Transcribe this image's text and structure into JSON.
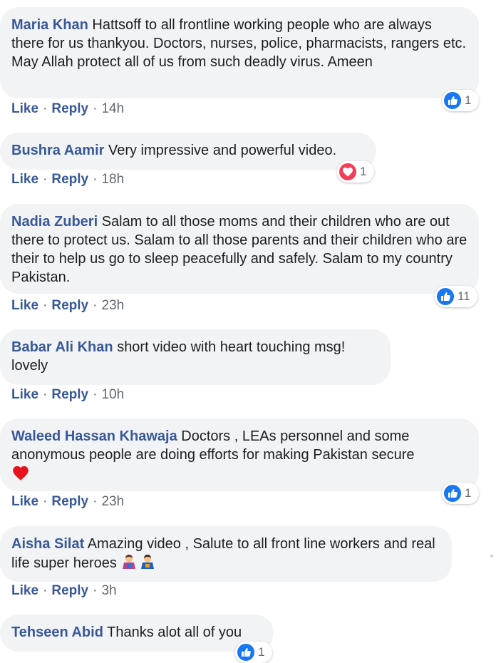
{
  "colors": {
    "author": "#385898",
    "bubble": "#f2f3f5",
    "like_blue": "#1877f2",
    "heart_red": "#f33e58"
  },
  "comments": [
    {
      "author": "Maria Khan",
      "text": "Hattsoff to all frontline working people who are always there for us thankyou. Doctors, nurses, police, pharmacists, rangers etc. May Allah protect all of us from such deadly virus. Ameen",
      "like": "Like",
      "reply": "Reply",
      "time": "14h",
      "reaction_type": "like",
      "reaction_count": "1"
    },
    {
      "author": "Bushra Aamir",
      "text": "Very impressive and powerful video.",
      "like": "Like",
      "reply": "Reply",
      "time": "18h",
      "reaction_type": "love",
      "reaction_count": "1"
    },
    {
      "author": "Nadia Zuberi",
      "text": "Salam to all those moms and their children who are out there to protect us. Salam to all those parents and their children who are their to help us go to sleep peacefully and safely. Salam to my country Pakistan.",
      "like": "Like",
      "reply": "Reply",
      "time": "23h",
      "reaction_type": "like",
      "reaction_count": "11"
    },
    {
      "author": "Babar Ali Khan",
      "text": "short video with heart touching msg! lovely",
      "like": "Like",
      "reply": "Reply",
      "time": "10h"
    },
    {
      "author": "Waleed Hassan Khawaja",
      "text": "Doctors , LEAs personnel and some anonymous people are doing efforts for making Pakistan secure",
      "emoji": "heart-emoji",
      "like": "Like",
      "reply": "Reply",
      "time": "23h",
      "reaction_type": "like",
      "reaction_count": "1"
    },
    {
      "author": "Aisha Silat",
      "text": "Amazing video , Salute to all front line workers and real life super heroes",
      "emoji": "superhero-emoji",
      "like": "Like",
      "reply": "Reply",
      "time": "3h"
    },
    {
      "author": "Tehseen Abid",
      "text": "Thanks alot all of you",
      "reaction_type": "like",
      "reaction_count": "1"
    }
  ],
  "separator": "·"
}
